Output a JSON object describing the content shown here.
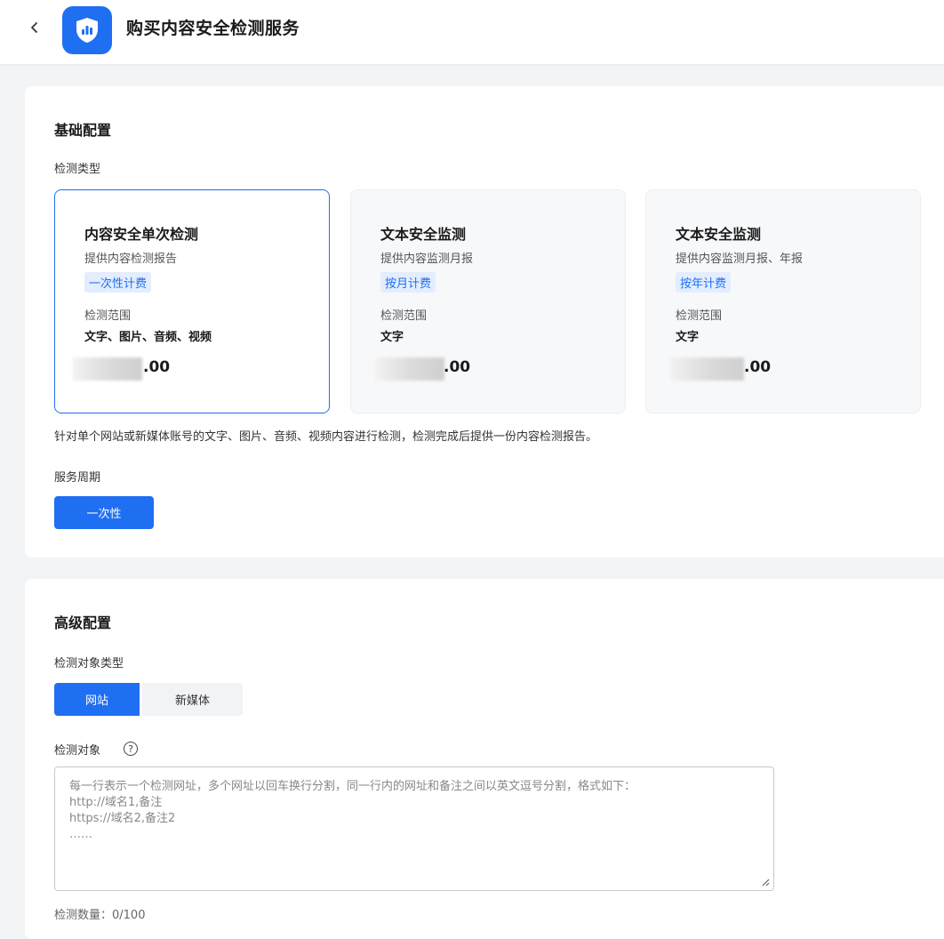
{
  "header": {
    "title": "购买内容安全检测服务"
  },
  "basic_config": {
    "section_title": "基础配置",
    "detection_type_label": "检测类型",
    "cards": [
      {
        "title": "内容安全单次检测",
        "desc": "提供内容检测报告",
        "tag": "一次性计费",
        "range_label": "检测范围",
        "range_value": "文字、图片、音频、视频",
        "price_decimal": ".00",
        "selected": true
      },
      {
        "title": "文本安全监测",
        "desc": "提供内容监测月报",
        "tag": "按月计费",
        "range_label": "检测范围",
        "range_value": "文字",
        "price_decimal": ".00",
        "selected": false
      },
      {
        "title": "文本安全监测",
        "desc": "提供内容监测月报、年报",
        "tag": "按年计费",
        "range_label": "检测范围",
        "range_value": "文字",
        "price_decimal": ".00",
        "selected": false
      }
    ],
    "description": "针对单个网站或新媒体账号的文字、图片、音频、视频内容进行检测，检测完成后提供一份内容检测报告。",
    "service_period_label": "服务周期",
    "service_period_value": "一次性"
  },
  "advanced_config": {
    "section_title": "高级配置",
    "target_type_label": "检测对象类型",
    "target_types": [
      "网站",
      "新媒体"
    ],
    "selected_target_type": "网站",
    "target_label": "检测对象",
    "help_symbol": "?",
    "textarea_placeholder": "每一行表示一个检测网址，多个网址以回车换行分割，同一行内的网址和备注之间以英文逗号分割，格式如下：\nhttp://域名1,备注\nhttps://域名2,备注2\n……",
    "textarea_value": "",
    "count_text": "检测数量：0/100"
  },
  "colors": {
    "accent": "#1f6ff2",
    "accent_light": "#e3edfd",
    "page_bg": "#f3f4f6",
    "card_bg": "#f7f8fa"
  },
  "icons": {
    "back": "chevron-left-icon",
    "logo": "shield-chart-icon",
    "help": "question-circle-icon",
    "resize": "resize-handle-icon"
  }
}
